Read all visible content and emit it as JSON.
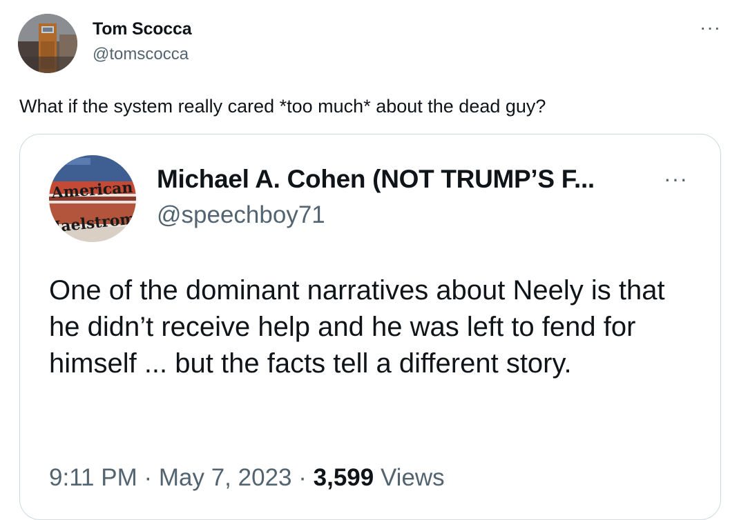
{
  "tweet": {
    "author_name": "Tom Scocca",
    "author_handle": "@tomscocca",
    "more_icon": "more-horizontal-icon",
    "more_glyph": "···",
    "text": "What if the system really cared *too much* about the dead guy?"
  },
  "quoted": {
    "author_name": "Michael A. Cohen (NOT TRUMP’S F...",
    "author_handle": "@speechboy71",
    "more_glyph": "···",
    "avatar_text_top": "American",
    "avatar_text_bottom": "Maelstrom",
    "text": "One of the dominant narratives about Neely is that he didn’t receive help and he was left to fend for himself ... but the facts tell a different story.",
    "time": "9:11 PM",
    "separator": "·",
    "date": "May 7, 2023",
    "views_count": "3,599",
    "views_label": "Views"
  },
  "colors": {
    "text_primary": "#0f1419",
    "text_secondary": "#536471",
    "border": "#cfd9de"
  }
}
